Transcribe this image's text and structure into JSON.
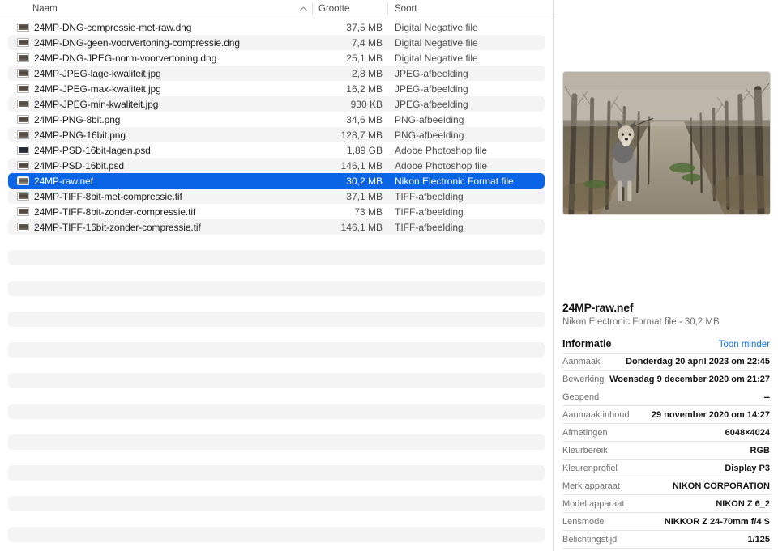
{
  "columns": {
    "name": "Naam",
    "size": "Grootte",
    "kind": "Soort",
    "sort_icon": "chevron-up-icon"
  },
  "files": [
    {
      "name": "24MP-DNG-compressie-met-raw.dng",
      "size": "37,5 MB",
      "kind": "Digital Negative file",
      "icon": "image-thumb-icon"
    },
    {
      "name": "24MP-DNG-geen-voorvertoning-compressie.dng",
      "size": "7,4 MB",
      "kind": "Digital Negative file",
      "icon": "image-thumb-icon"
    },
    {
      "name": "24MP-DNG-JPEG-norm-voorvertoning.dng",
      "size": "25,1 MB",
      "kind": "Digital Negative file",
      "icon": "image-thumb-icon"
    },
    {
      "name": "24MP-JPEG-lage-kwaliteit.jpg",
      "size": "2,8 MB",
      "kind": "JPEG-afbeelding",
      "icon": "image-thumb-icon"
    },
    {
      "name": "24MP-JPEG-max-kwaliteit.jpg",
      "size": "16,2 MB",
      "kind": "JPEG-afbeelding",
      "icon": "image-thumb-icon"
    },
    {
      "name": "24MP-JPEG-min-kwaliteit.jpg",
      "size": "930 KB",
      "kind": "JPEG-afbeelding",
      "icon": "image-thumb-icon"
    },
    {
      "name": "24MP-PNG-8bit.png",
      "size": "34,6 MB",
      "kind": "PNG-afbeelding",
      "icon": "image-thumb-icon"
    },
    {
      "name": "24MP-PNG-16bit.png",
      "size": "128,7 MB",
      "kind": "PNG-afbeelding",
      "icon": "image-thumb-icon"
    },
    {
      "name": "24MP-PSD-16bit-lagen.psd",
      "size": "1,89 GB",
      "kind": "Adobe Photoshop file",
      "icon": "psd-thumb-icon"
    },
    {
      "name": "24MP-PSD-16bit.psd",
      "size": "146,1 MB",
      "kind": "Adobe Photoshop file",
      "icon": "image-thumb-icon"
    },
    {
      "name": "24MP-raw.nef",
      "size": "30,2 MB",
      "kind": "Nikon Electronic Format file",
      "icon": "raw-thumb-icon",
      "selected": true
    },
    {
      "name": "24MP-TIFF-8bit-met-compressie.tif",
      "size": "37,1 MB",
      "kind": "TIFF-afbeelding",
      "icon": "image-thumb-icon"
    },
    {
      "name": "24MP-TIFF-8bit-zonder-compressie.tif",
      "size": "73 MB",
      "kind": "TIFF-afbeelding",
      "icon": "image-thumb-icon"
    },
    {
      "name": "24MP-TIFF-16bit-zonder-compressie.tif",
      "size": "146,1 MB",
      "kind": "TIFF-afbeelding",
      "icon": "image-thumb-icon"
    }
  ],
  "info": {
    "preview_alt": "dog-on-forest-path-preview",
    "title": "24MP-raw.nef",
    "subtitle": "Nikon Electronic Format file - 30,2 MB",
    "section_title": "Informatie",
    "toggle_label": "Toon minder",
    "metadata": [
      {
        "key": "Aanmaak",
        "value": "Donderdag 20 april 2023 om 22:45"
      },
      {
        "key": "Bewerking",
        "value": "Woensdag 9 december 2020 om 21:27"
      },
      {
        "key": "Geopend",
        "value": "--"
      },
      {
        "key": "Aanmaak inhoud",
        "value": "29 november 2020 om 14:27"
      },
      {
        "key": "Afmetingen",
        "value": "6048×4024"
      },
      {
        "key": "Kleurbereik",
        "value": "RGB"
      },
      {
        "key": "Kleurenprofiel",
        "value": "Display P3"
      },
      {
        "key": "Merk apparaat",
        "value": "NIKON CORPORATION"
      },
      {
        "key": "Model apparaat",
        "value": "NIKON Z 6_2"
      },
      {
        "key": "Lensmodel",
        "value": "NIKKOR Z 24-70mm f/4 S"
      },
      {
        "key": "Belichtingstijd",
        "value": "1/125"
      }
    ]
  },
  "colors": {
    "selection_blue": "#0a64e6",
    "link_blue": "#1272e8",
    "row_stripe": "#f4f4f4"
  }
}
